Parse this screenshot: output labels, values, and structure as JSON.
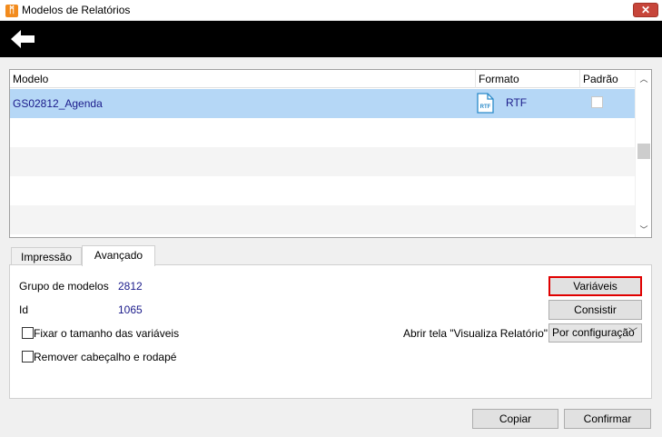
{
  "window": {
    "title": "Modelos de Relatórios",
    "close_label": "✕"
  },
  "toolbar": {
    "back_icon": "arrow-left-icon"
  },
  "grid": {
    "columns": [
      "Modelo",
      "Formato",
      "Padrão"
    ],
    "rows": [
      {
        "modelo": "GS02812_Agenda",
        "formato": "RTF",
        "icon_text": "RTF",
        "padrao": false,
        "selected": true
      }
    ]
  },
  "tabs": [
    {
      "label": "Impressão",
      "active": false
    },
    {
      "label": "Avançado",
      "active": true
    }
  ],
  "form": {
    "grupo_label": "Grupo de modelos",
    "grupo_value": "2812",
    "id_label": "Id",
    "id_value": "1065",
    "fixar_label": "Fixar o tamanho das variáveis",
    "remover_label": "Remover cabeçalho e rodapé",
    "abrir_label": "Abrir tela \"Visualiza Relatório\"",
    "abrir_value": "Por configuração",
    "variaveis_button": "Variáveis",
    "consistir_button": "Consistir"
  },
  "footer": {
    "copiar_button": "Copiar",
    "confirmar_button": "Confirmar"
  },
  "colors": {
    "selection": "#b5d7f6",
    "value_text": "#1a1a8a",
    "focus_border": "#e00000",
    "toolbar_bg": "#000000"
  }
}
